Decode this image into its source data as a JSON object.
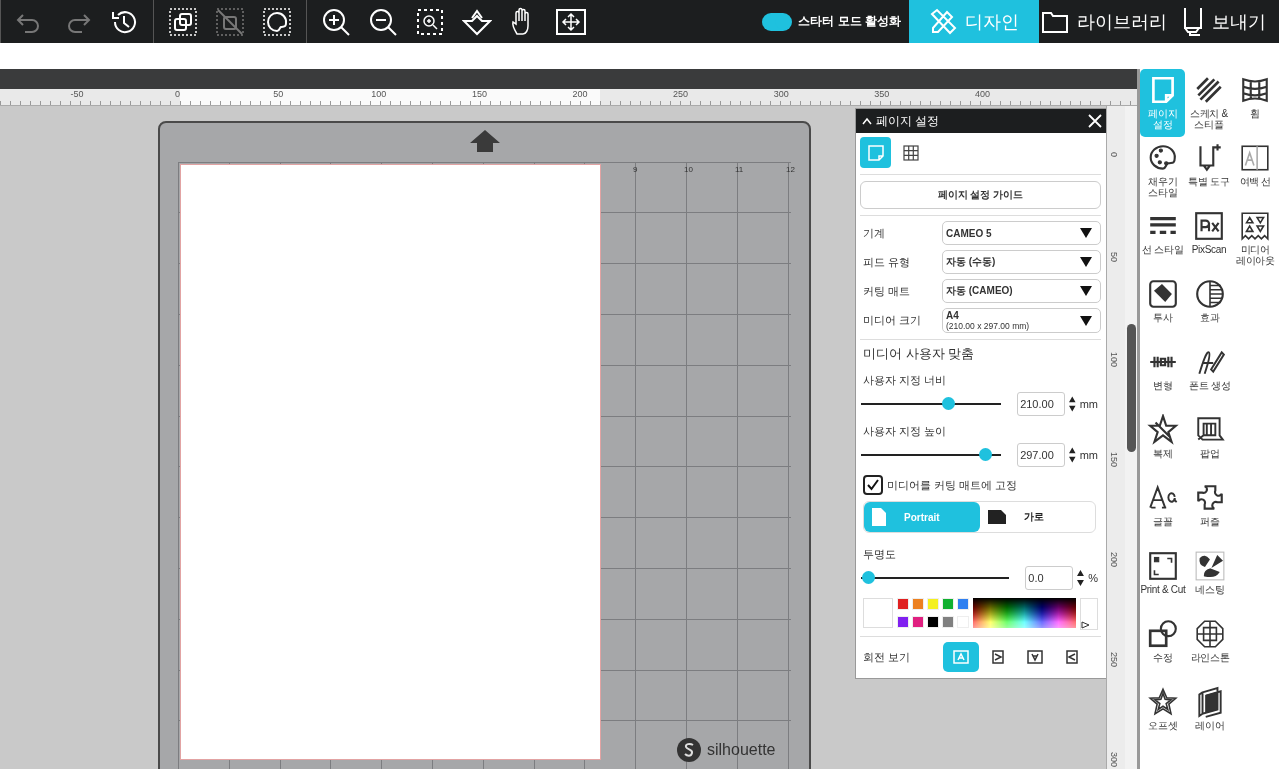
{
  "toolbar": {
    "groups": [
      [
        {
          "disabled": true
        },
        {
          "disabled": true
        },
        {
          "disabled": false
        }
      ],
      [
        {
          "disabled": false
        },
        {
          "disabled": true
        },
        {
          "disabled": false
        }
      ],
      [
        {
          "disabled": false
        },
        {
          "disabled": false
        },
        {
          "disabled": false
        },
        {
          "disabled": false
        },
        {
          "disabled": false
        },
        {
          "disabled": false
        }
      ]
    ],
    "starter_mode": {
      "label": "스타터 모드 활성화",
      "on": true
    },
    "tabs": [
      {
        "label": "디자인",
        "selected": true
      },
      {
        "label": "라이브러리",
        "selected": false
      },
      {
        "label": "보내기",
        "selected": false
      }
    ]
  },
  "ruler": {
    "labels": [
      "-50",
      "0",
      "50",
      "100",
      "150",
      "200",
      "250",
      "300",
      "350",
      "400"
    ]
  },
  "vertical_ruler": {
    "labels": [
      "0",
      "50",
      "100",
      "150",
      "200",
      "250",
      "300"
    ]
  },
  "mat": {
    "column_numbers": [
      "9",
      "10",
      "11",
      "12"
    ],
    "brand": "silhouette"
  },
  "page_panel": {
    "title": "페이지 설정",
    "view_tabs": [
      {
        "selected": true
      },
      {
        "selected": false
      }
    ],
    "guide_button": "페이지 설정 가이드",
    "settings": [
      {
        "label": "기계",
        "value": "CAMEO 5"
      },
      {
        "label": "피드 유형",
        "value": "자동 (수동)"
      },
      {
        "label": "커팅 매트",
        "value": "자동 (CAMEO)"
      },
      {
        "label": "미디어 크기",
        "value": "A4",
        "detail": "(210.00 x 297.00 mm)"
      }
    ],
    "custom_heading": "미디어 사용자 맞춤",
    "sliders": [
      {
        "label": "사용자 지정 너비",
        "level": 0.64,
        "value": "210.00",
        "unit": "mm"
      },
      {
        "label": "사용자 지정 높이",
        "level": 0.93,
        "value": "297.00",
        "unit": "mm"
      }
    ],
    "lock_checkbox": {
      "label": "미디어를 커팅 매트에 고정",
      "checked": true
    },
    "orientation": [
      {
        "label": "Portrait",
        "selected": true
      },
      {
        "label": "가로",
        "selected": false
      }
    ],
    "opacity": {
      "label": "투명도",
      "level": 0,
      "value": "0.0",
      "unit": "%"
    },
    "swatches": [
      {
        "color": "#e02020"
      },
      {
        "color": "#ec8020"
      },
      {
        "color": "#f4f020"
      },
      {
        "color": "#10b030"
      },
      {
        "color": "#3080f0"
      },
      {
        "color": "#8020f0"
      },
      {
        "color": "#e02080"
      },
      {
        "color": "#000000"
      },
      {
        "color": "#808080"
      },
      {
        "color": "#ffffff"
      }
    ],
    "rotation": {
      "label": "회전 보기",
      "buttons": [
        {
          "selected": true
        },
        {
          "selected": false
        },
        {
          "selected": false
        },
        {
          "selected": false
        }
      ]
    }
  },
  "tool_rows": [
    [
      {
        "label": "페이지 설정",
        "selected": true
      },
      {
        "label": "스케치 & 스티플",
        "selected": false
      },
      {
        "label": "휨",
        "selected": false
      }
    ],
    [
      {
        "label": "채우기 스타일",
        "selected": false
      },
      {
        "label": "특별 도구",
        "selected": false
      },
      {
        "label": "여백 선",
        "selected": false
      }
    ],
    [
      {
        "label": "선 스타일",
        "selected": false
      },
      {
        "label": "PixScan",
        "selected": false
      },
      {
        "label": "미디어 레이아웃",
        "selected": false
      }
    ],
    [
      {
        "label": "투사",
        "selected": false
      },
      {
        "label": "효과",
        "selected": false
      }
    ],
    [
      {
        "label": "변형",
        "selected": false
      },
      {
        "label": "폰트 생성",
        "selected": false
      }
    ],
    [
      {
        "label": "복제",
        "selected": false
      },
      {
        "label": "팝업",
        "selected": false
      }
    ],
    [
      {
        "label": "글꼴",
        "selected": false
      },
      {
        "label": "퍼즐",
        "selected": false
      }
    ],
    [
      {
        "label": "Print & Cut",
        "selected": false
      },
      {
        "label": "네스팅",
        "selected": false
      }
    ],
    [
      {
        "label": "수정",
        "selected": false
      },
      {
        "label": "라인스톤",
        "selected": false
      }
    ],
    [
      {
        "label": "오프셋",
        "selected": false
      },
      {
        "label": "레이어",
        "selected": false
      }
    ]
  ]
}
